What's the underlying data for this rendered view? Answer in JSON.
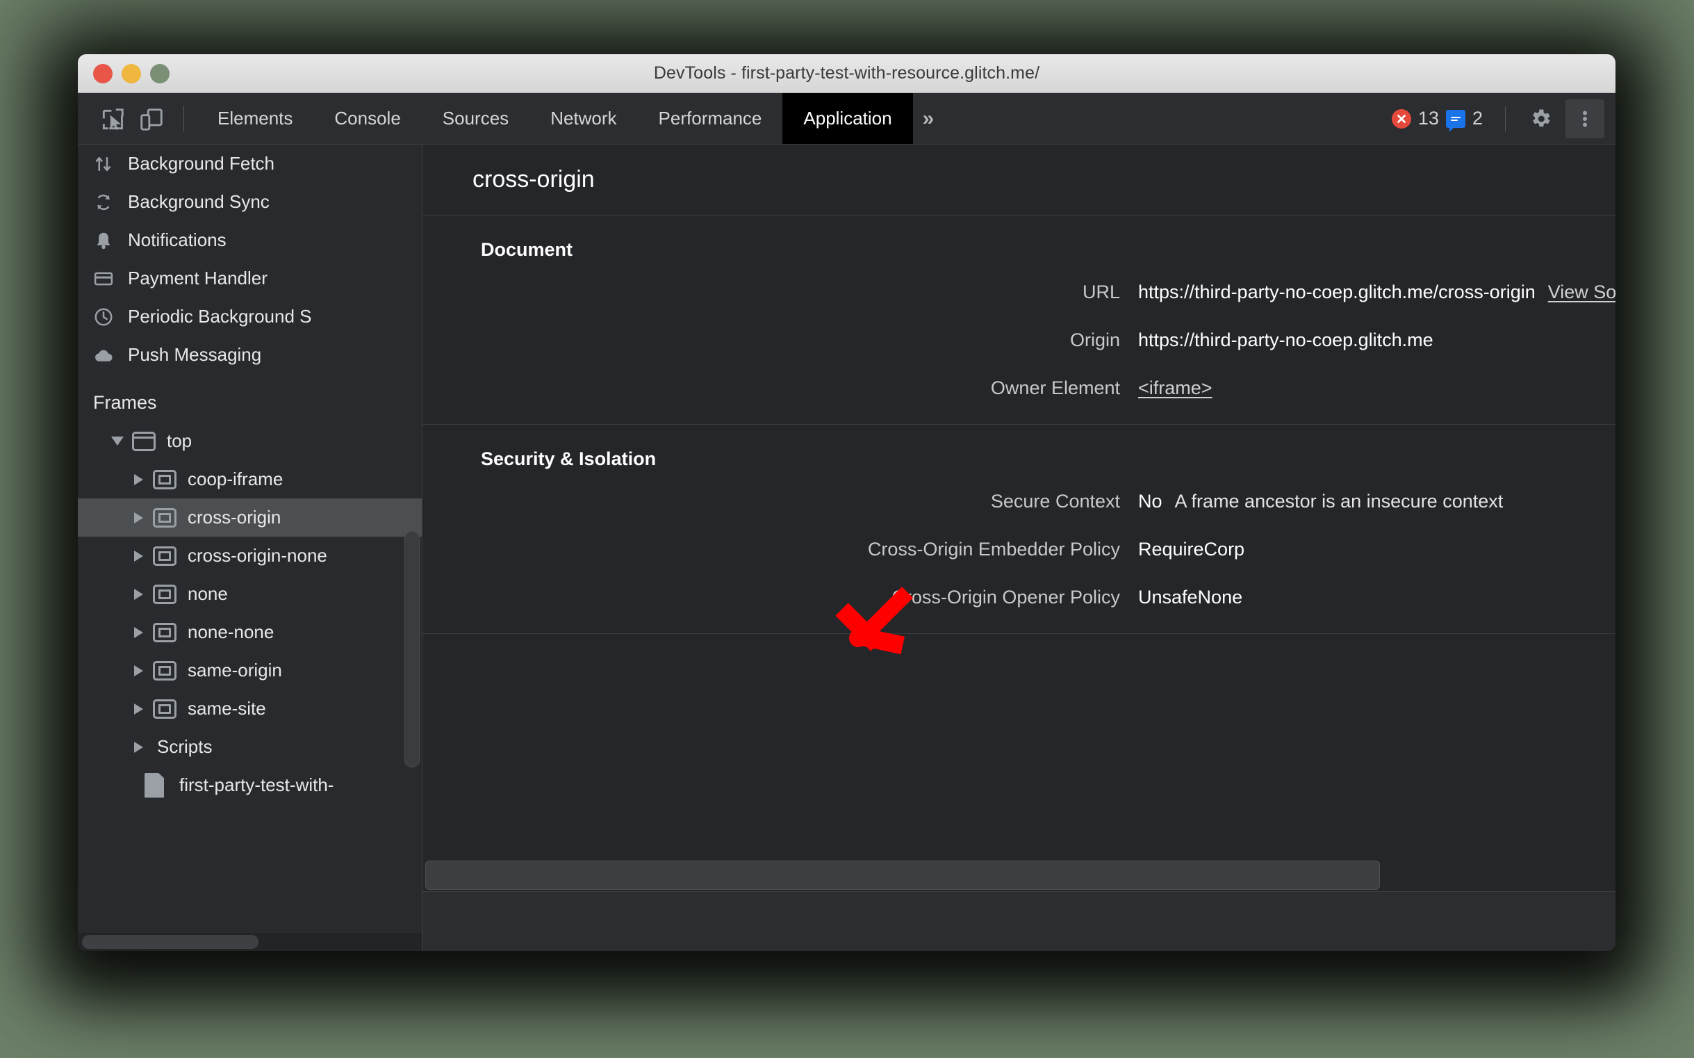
{
  "window": {
    "title": "DevTools - first-party-test-with-resource.glitch.me/",
    "traffic_lights": [
      "close",
      "minimize",
      "zoom"
    ]
  },
  "toolbar": {
    "inspect_icon": "inspect-element-icon",
    "device_icon": "device-toolbar-icon",
    "tabs": [
      {
        "label": "Elements",
        "selected": false
      },
      {
        "label": "Console",
        "selected": false
      },
      {
        "label": "Sources",
        "selected": false
      },
      {
        "label": "Network",
        "selected": false
      },
      {
        "label": "Performance",
        "selected": false
      },
      {
        "label": "Application",
        "selected": true
      }
    ],
    "more_tabs_label": "»",
    "error_count": "13",
    "message_count": "2",
    "error_icon": "error-circle-icon",
    "message_icon": "message-bubble-icon",
    "settings_icon": "gear-icon",
    "more_icon": "kebab-menu-icon"
  },
  "sidebar": {
    "background_services": [
      {
        "label": "Background Fetch",
        "icon": "updown-arrows-icon"
      },
      {
        "label": "Background Sync",
        "icon": "sync-icon"
      },
      {
        "label": "Notifications",
        "icon": "bell-icon"
      },
      {
        "label": "Payment Handler",
        "icon": "credit-card-icon"
      },
      {
        "label": "Periodic Background S",
        "icon": "clock-icon"
      },
      {
        "label": "Push Messaging",
        "icon": "cloud-icon"
      }
    ],
    "frames_section_title": "Frames",
    "frames": [
      {
        "label": "top",
        "depth": 0,
        "expanded": true,
        "selected": false,
        "icon": "frame-icon"
      },
      {
        "label": "coop-iframe",
        "depth": 1,
        "expanded": false,
        "selected": false,
        "icon": "nested-frame-icon"
      },
      {
        "label": "cross-origin",
        "depth": 1,
        "expanded": false,
        "selected": true,
        "icon": "nested-frame-icon"
      },
      {
        "label": "cross-origin-none",
        "depth": 1,
        "expanded": false,
        "selected": false,
        "icon": "nested-frame-icon"
      },
      {
        "label": "none",
        "depth": 1,
        "expanded": false,
        "selected": false,
        "icon": "nested-frame-icon"
      },
      {
        "label": "none-none",
        "depth": 1,
        "expanded": false,
        "selected": false,
        "icon": "nested-frame-icon"
      },
      {
        "label": "same-origin",
        "depth": 1,
        "expanded": false,
        "selected": false,
        "icon": "nested-frame-icon"
      },
      {
        "label": "same-site",
        "depth": 1,
        "expanded": false,
        "selected": false,
        "icon": "nested-frame-icon"
      }
    ],
    "scripts": {
      "label": "Scripts",
      "expanded": false
    },
    "script_file": {
      "label": "first-party-test-with-",
      "icon": "document-icon"
    }
  },
  "main": {
    "title": "cross-origin",
    "sections": [
      {
        "heading": "Document",
        "rows": [
          {
            "key": "URL",
            "value": "https://third-party-no-coep.glitch.me/cross-origin",
            "link": "View Source",
            "link_name": "view-source-link"
          },
          {
            "key": "Origin",
            "value": "https://third-party-no-coep.glitch.me"
          },
          {
            "key": "Owner Element",
            "value": "<iframe>",
            "value_is_link": true
          }
        ]
      },
      {
        "heading": "Security & Isolation",
        "rows": [
          {
            "key": "Secure Context",
            "value": "No",
            "sub": "A frame ancestor is an insecure context"
          },
          {
            "key": "Cross-Origin Embedder Policy",
            "value": "RequireCorp"
          },
          {
            "key": "Cross-Origin Opener Policy",
            "value": "UnsafeNone"
          }
        ]
      }
    ]
  },
  "annotation": {
    "arrow_color": "#ff0000",
    "arrow_name": "red-annotation-arrow",
    "points_at": "Security & Isolation"
  },
  "colors": {
    "page_background": "#6d8169",
    "panel_background": "#242629",
    "sidebar_background": "#282a2d",
    "toolbar_background": "#2b2d30",
    "selected_tab_background": "#000000",
    "selected_row_background": "#4c4f52",
    "error_red": "#e5493b",
    "message_blue": "#1a73e8",
    "annotation_red": "#ff0000"
  }
}
